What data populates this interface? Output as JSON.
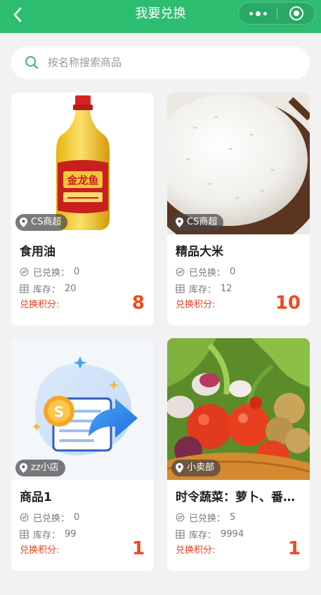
{
  "header": {
    "title": "我要兑换",
    "back_icon": "chevron-left-icon",
    "more_icon": "more-dots-icon",
    "close_icon": "target-close-icon",
    "color": "#2dbd70"
  },
  "search": {
    "placeholder": "按名称搜索商品",
    "value": "",
    "icon": "search-icon"
  },
  "labels": {
    "exchanged": "已兑换：",
    "stock": "库存：",
    "points": "兑换积分:"
  },
  "products": [
    {
      "name": "食用油",
      "store": "CS商超",
      "exchanged": "0",
      "stock": "20",
      "points": "8",
      "bottle_brand": "金龙鱼"
    },
    {
      "name": "精品大米",
      "store": "CS商超",
      "exchanged": "0",
      "stock": "12",
      "points": "10"
    },
    {
      "name": "商品1",
      "store": "zz小店",
      "exchanged": "0",
      "stock": "99",
      "points": "1",
      "coin_symbol": "S"
    },
    {
      "name": "时令蔬菜：萝卜、番茄、土豆",
      "store": "小卖部",
      "exchanged": "5",
      "stock": "9994",
      "points": "1"
    }
  ],
  "colors": {
    "accent": "#2dbd70",
    "points": "#ef4a1f",
    "background": "#f2f2f2"
  }
}
